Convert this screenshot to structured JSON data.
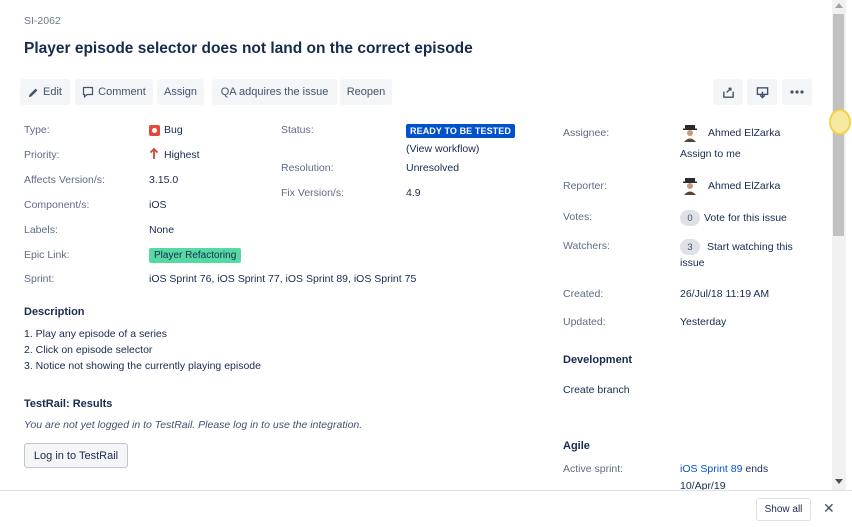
{
  "issue": {
    "key": "SI-2062",
    "title": "Player episode selector does not land on the correct episode"
  },
  "toolbar": {
    "edit": "Edit",
    "comment": "Comment",
    "assign": "Assign",
    "qa": "QA adquires the issue",
    "reopen": "Reopen"
  },
  "fields": {
    "type_label": "Type:",
    "type_value": "Bug",
    "priority_label": "Priority:",
    "priority_value": "Highest",
    "affects_label": "Affects Version/s:",
    "affects_value": "3.15.0",
    "component_label": "Component/s:",
    "component_value": "iOS",
    "labels_label": "Labels:",
    "labels_value": "None",
    "epic_label": "Epic Link:",
    "epic_value": "Player Refactoring",
    "sprint_label": "Sprint:",
    "sprint_value": "iOS Sprint 76, iOS Sprint 77, iOS Sprint 89, iOS Sprint 75",
    "status_label": "Status:",
    "status_value": "READY TO BE TESTED",
    "view_workflow": "(View workflow)",
    "resolution_label": "Resolution:",
    "resolution_value": "Unresolved",
    "fix_label": "Fix Version/s:",
    "fix_value": "4.9"
  },
  "description": {
    "heading": "Description",
    "lines": [
      "1. Play any episode of a series",
      "2. Click on episode selector",
      "3. Notice not showing the currently playing episode"
    ]
  },
  "testrail": {
    "heading": "TestRail: Results",
    "message": "You are not yet logged in to TestRail. Please log in to use the integration.",
    "login_button": "Log in to TestRail"
  },
  "people": {
    "assignee_label": "Assignee:",
    "assignee_name": "Ahmed ElZarka",
    "assign_to_me": "Assign to me",
    "reporter_label": "Reporter:",
    "reporter_name": "Ahmed ElZarka",
    "votes_label": "Votes:",
    "votes_count": "0",
    "vote_link": "Vote for this issue",
    "watchers_label": "Watchers:",
    "watchers_count": "3",
    "watch_link_1": "Start watching this",
    "watch_link_2": "issue"
  },
  "dates": {
    "created_label": "Created:",
    "created_value": "26/Jul/18 11:19 AM",
    "updated_label": "Updated:",
    "updated_value": "Yesterday"
  },
  "development": {
    "heading": "Development",
    "create_branch": "Create branch"
  },
  "agile": {
    "heading": "Agile",
    "active_sprint_label": "Active sprint:",
    "active_sprint_link": "iOS Sprint 89",
    "active_sprint_suffix": "ends",
    "active_sprint_date": "10/Apr/19"
  },
  "footer": {
    "show_all": "Show all",
    "close": "✕"
  },
  "colors": {
    "link": "#0052cc",
    "status_blue": "#0052cc",
    "epic_green": "#57d9a3",
    "bug_red": "#e5493a",
    "priority_red": "#d04437"
  }
}
